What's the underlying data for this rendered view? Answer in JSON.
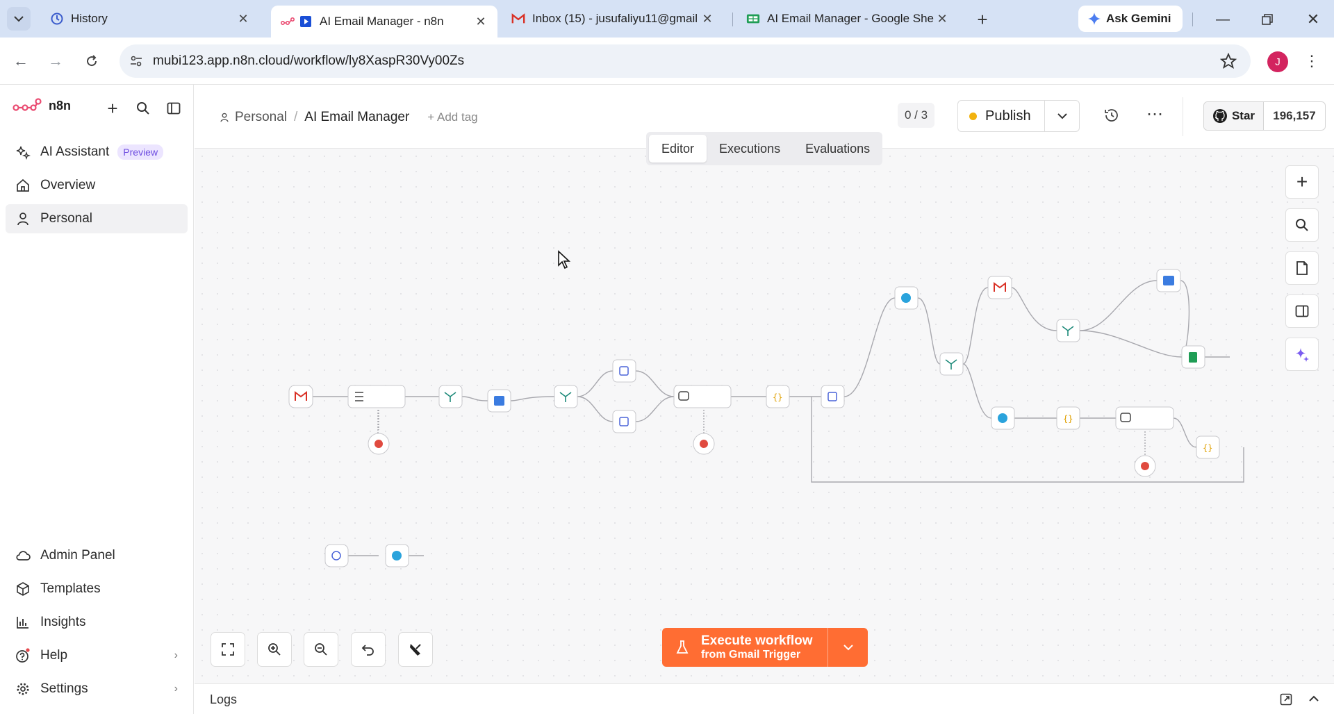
{
  "tabs": [
    {
      "title": "History",
      "active": false
    },
    {
      "title": "AI Email Manager - n8n",
      "active": true
    },
    {
      "title": "Inbox (15) - jusufaliyu11@gmail",
      "active": false
    },
    {
      "title": "AI Email Manager - Google She",
      "active": false
    }
  ],
  "ask_gemini": "Ask Gemini",
  "address": {
    "url": "mubi123.app.n8n.cloud/workflow/ly8XaspR30Vy00Zs"
  },
  "profile_initial": "J",
  "sidebar": {
    "brand": "n8n",
    "items": [
      {
        "label": "AI Assistant",
        "badge": "Preview"
      },
      {
        "label": "Overview"
      },
      {
        "label": "Personal"
      }
    ],
    "bottom_items": [
      {
        "label": "Admin Panel"
      },
      {
        "label": "Templates"
      },
      {
        "label": "Insights"
      },
      {
        "label": "Help"
      },
      {
        "label": "Settings"
      }
    ]
  },
  "header": {
    "breadcrumb_project": "Personal",
    "breadcrumb_sep": "/",
    "workflow_name": "AI Email Manager",
    "add_tag": "+ Add tag",
    "counter": "0 / 3",
    "publish_label": "Publish",
    "github_star": "Star",
    "github_count": "196,157"
  },
  "view_tabs": [
    {
      "label": "Editor",
      "active": true
    },
    {
      "label": "Executions",
      "active": false
    },
    {
      "label": "Evaluations",
      "active": false
    }
  ],
  "execute": {
    "line1": "Execute workflow",
    "line2": "from Gmail Trigger"
  },
  "logs_label": "Logs",
  "colors": {
    "accent": "#ff6d33",
    "publish_dot": "#f2b20f",
    "ai_badge_text": "#6d4ce0",
    "error_node": "#e04a3f",
    "telegram": "#2aa3dc",
    "gmail_red": "#d93025",
    "sheets_green": "#1f9d55"
  }
}
